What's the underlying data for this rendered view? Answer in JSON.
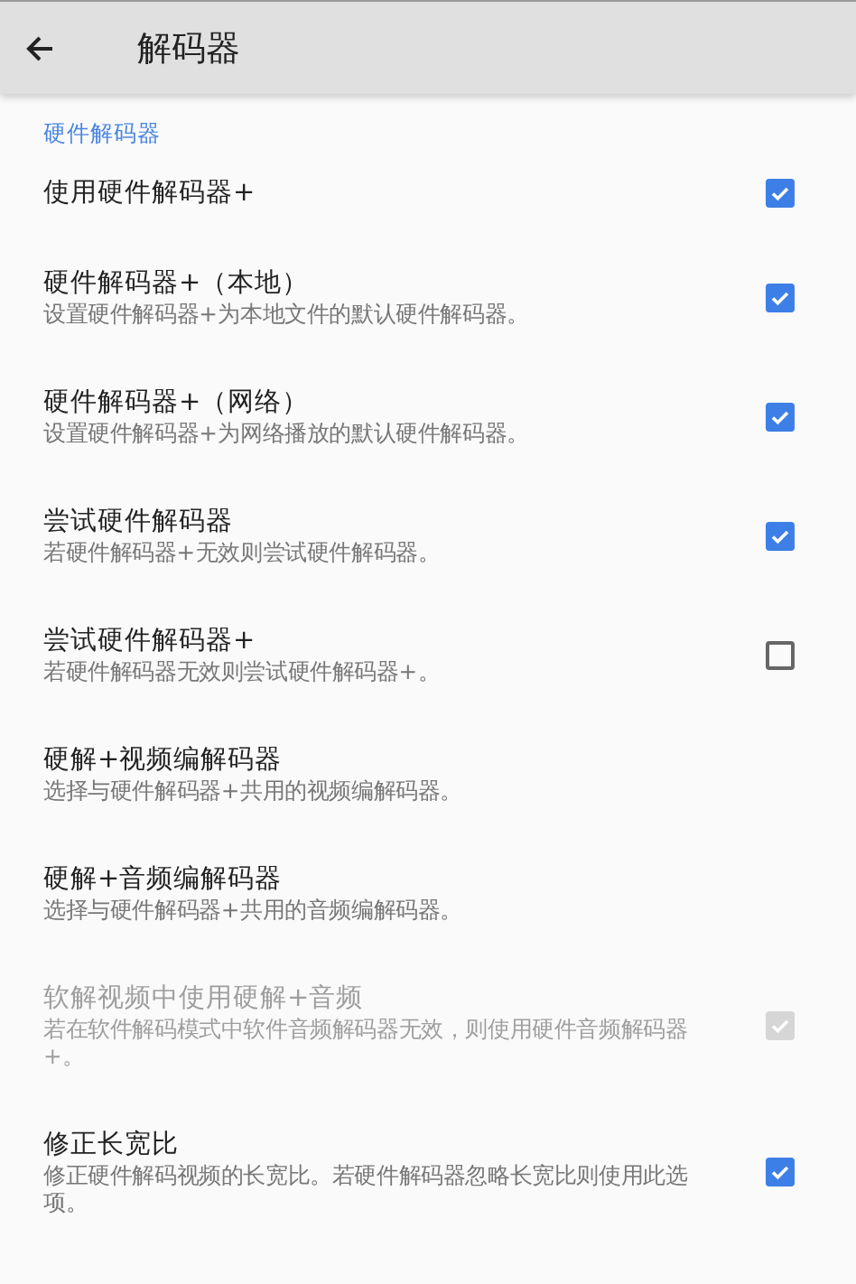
{
  "app_bar": {
    "title": "解码器"
  },
  "section": {
    "header": "硬件解码器"
  },
  "items": [
    {
      "kind": "checkbox",
      "title": "使用硬件解码器+",
      "checked": true,
      "disabled": false
    },
    {
      "kind": "checkbox",
      "title": "硬件解码器+（本地）",
      "subtitle": "设置硬件解码器+为本地文件的默认硬件解码器。",
      "checked": true,
      "disabled": false
    },
    {
      "kind": "checkbox",
      "title": "硬件解码器+（网络）",
      "subtitle": "设置硬件解码器+为网络播放的默认硬件解码器。",
      "checked": true,
      "disabled": false
    },
    {
      "kind": "checkbox",
      "title": "尝试硬件解码器",
      "subtitle": "若硬件解码器+无效则尝试硬件解码器。",
      "checked": true,
      "disabled": false
    },
    {
      "kind": "checkbox",
      "title": "尝试硬件解码器+",
      "subtitle": "若硬件解码器无效则尝试硬件解码器+。",
      "checked": false,
      "disabled": false
    },
    {
      "kind": "link",
      "title": "硬解+视频编解码器",
      "subtitle": "选择与硬件解码器+共用的视频编解码器。",
      "disabled": false
    },
    {
      "kind": "link",
      "title": "硬解+音频编解码器",
      "subtitle": "选择与硬件解码器+共用的音频编解码器。",
      "disabled": false
    },
    {
      "kind": "checkbox",
      "title": "软解视频中使用硬解+音频",
      "subtitle": "若在软件解码模式中软件音频解码器无效，则使用硬件音频解码器+。",
      "checked": true,
      "disabled": true
    },
    {
      "kind": "checkbox",
      "title": "修正长宽比",
      "subtitle": "修正硬件解码视频的长宽比。若硬件解码器忽略长宽比则使用此选项。",
      "checked": true,
      "disabled": false
    }
  ]
}
